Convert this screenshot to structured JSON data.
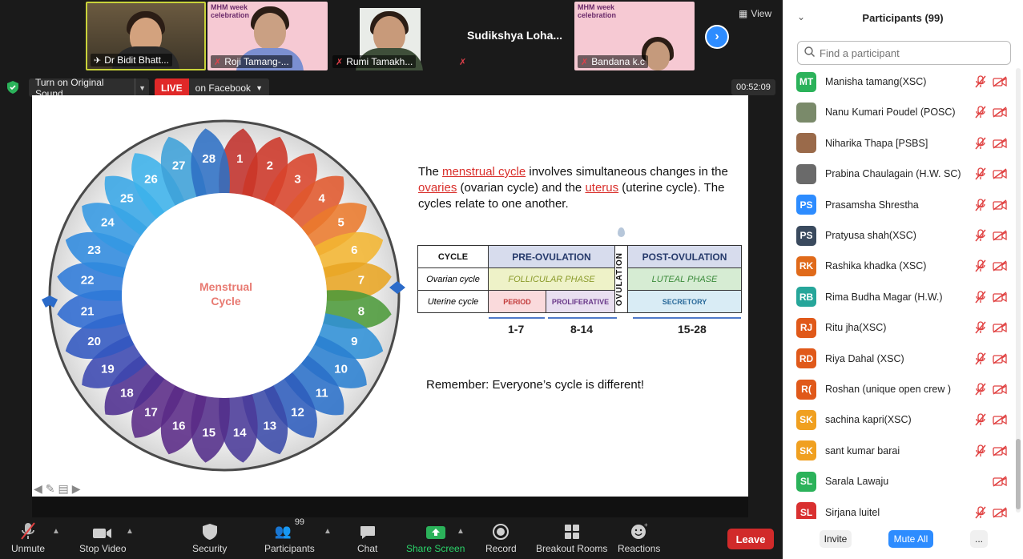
{
  "thumbnails": [
    {
      "name": "Dr Bidit Bhatt...",
      "muted": false
    },
    {
      "name": "Roji Tamang-...",
      "muted": true,
      "banner": "MHM week celebration"
    },
    {
      "name": "Rumi Tamakh...",
      "muted": true
    },
    {
      "name": "",
      "muted": true
    },
    {
      "name": "Bandana k.c",
      "muted": true,
      "banner": "MHM week celebration"
    }
  ],
  "active_speaker": "Sudikshya  Loha...",
  "view_label": "View",
  "share_bar": {
    "original_sound": "Turn on Original Sound",
    "live_badge": "LIVE",
    "live_target": "on Facebook",
    "timer": "00:52:09"
  },
  "slide": {
    "wheel_label_line1": "Menstrual",
    "wheel_label_line2": "Cycle",
    "intro_pre": "The ",
    "intro_link1": "menstrual cycle",
    "intro_mid1": " involves simultaneous changes in the ",
    "intro_link2": "ovaries",
    "intro_mid2": " (ovarian cycle) and the ",
    "intro_link3": "uterus",
    "intro_post": " (uterine cycle). The cycles relate to one another.",
    "table": {
      "cycle": "CYCLE",
      "pre": "PRE-OVULATION",
      "post": "POST-OVULATION",
      "ovulation": "OVULATION",
      "ovarian_label": "Ovarian cycle",
      "follicular": "FOLLICULAR PHASE",
      "luteal": "LUTEAL PHASE",
      "uterine_label": "Uterine cycle",
      "period": "PERIOD",
      "proliferative": "PROLIFERATIVE",
      "secretory": "SECRETORY"
    },
    "ranges": [
      "1-7",
      "8-14",
      "15-28"
    ],
    "remember": "Remember: Everyone’s cycle is different!",
    "days": [
      "1",
      "2",
      "3",
      "4",
      "5",
      "6",
      "7",
      "8",
      "9",
      "10",
      "11",
      "12",
      "13",
      "14",
      "15",
      "16",
      "17",
      "18",
      "19",
      "20",
      "21",
      "22",
      "23",
      "24",
      "25",
      "26",
      "27",
      "28"
    ]
  },
  "toolbar": {
    "unmute": "Unmute",
    "stop_video": "Stop Video",
    "security": "Security",
    "participants": "Participants",
    "participants_count": "99",
    "chat": "Chat",
    "share_screen": "Share Screen",
    "record": "Record",
    "breakout": "Breakout Rooms",
    "reactions": "Reactions",
    "leave": "Leave"
  },
  "panel": {
    "title": "Participants (99)",
    "search_placeholder": "Find a participant",
    "participants": [
      {
        "initials": "MT",
        "name": "Manisha tamang(XSC)",
        "color": "#2bb25a",
        "mic_muted": true
      },
      {
        "initials": "",
        "name": "Nanu Kumari Poudel (POSC)",
        "color": "#7a8a6a",
        "mic_muted": true,
        "photo": true
      },
      {
        "initials": "",
        "name": "Niharika Thapa [PSBS]",
        "color": "#9a6a4a",
        "mic_muted": true,
        "photo": true
      },
      {
        "initials": "",
        "name": "Prabina Chaulagain (H.W. SC)",
        "color": "#6a6a6a",
        "mic_muted": true,
        "photo": true
      },
      {
        "initials": "PS",
        "name": "Prasamsha Shrestha",
        "color": "#2d8cff",
        "mic_muted": true
      },
      {
        "initials": "PS",
        "name": "Pratyusa shah(XSC)",
        "color": "#3a4a5e",
        "mic_muted": true
      },
      {
        "initials": "RK",
        "name": "Rashika khadka (XSC)",
        "color": "#e06a1a",
        "mic_muted": true
      },
      {
        "initials": "RB",
        "name": "Rima Budha Magar (H.W.)",
        "color": "#26a69a",
        "mic_muted": true
      },
      {
        "initials": "RJ",
        "name": "Ritu jha(XSC)",
        "color": "#e0591a",
        "mic_muted": true
      },
      {
        "initials": "RD",
        "name": "Riya Dahal (XSC)",
        "color": "#e0591a",
        "mic_muted": true
      },
      {
        "initials": "R(",
        "name": "Roshan (unique open crew )",
        "color": "#e0591a",
        "mic_muted": true
      },
      {
        "initials": "SK",
        "name": "sachina kapri(XSC)",
        "color": "#f0a020",
        "mic_muted": true
      },
      {
        "initials": "SK",
        "name": "sant kumar barai",
        "color": "#f0a020",
        "mic_muted": true
      },
      {
        "initials": "SL",
        "name": "Sarala  Lawaju",
        "color": "#2bb25a",
        "mic_muted": false
      },
      {
        "initials": "SL",
        "name": "Sirjana luitel",
        "color": "#d93030",
        "mic_muted": true
      }
    ],
    "invite": "Invite",
    "mute_all": "Mute All",
    "more": "..."
  }
}
